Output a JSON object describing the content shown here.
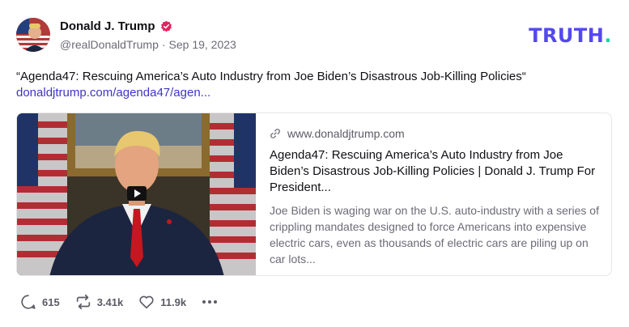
{
  "author": {
    "display_name": "Donald J. Trump",
    "handle": "@realDonaldTrump",
    "separator": "·",
    "date": "Sep 19, 2023",
    "verified_icon": "verified-badge-icon",
    "verified_color": "#e0245e"
  },
  "brand": {
    "logo_text": "TRUTH",
    "logo_dot": ".",
    "logo_color": "#5448ee",
    "logo_dot_color": "#1dd5a6"
  },
  "status": {
    "text": "“Agenda47: Rescuing America’s Auto Industry from Joe Biden’s Disastrous Job-Killing Policies“",
    "link_text": "donaldjtrump.com/agenda47/agen..."
  },
  "card": {
    "domain": "www.donaldjtrump.com",
    "link_icon": "link-icon",
    "title": "Agenda47: Rescuing America’s Auto Industry from Joe Biden’s Disastrous Job-Killing Policies | Donald J. Trump For President...",
    "description": "Joe Biden is waging war on the U.S. auto-industry with a series of crippling mandates designed to force Americans into expensive electric cars, even as thousands of electric cars are piling up on car lots...",
    "media_type": "video",
    "play_icon": "play-icon"
  },
  "actions": {
    "replies": "615",
    "retruths": "3.41k",
    "likes": "11.9k",
    "reply_icon": "reply-icon",
    "retruth_icon": "retruth-icon",
    "like_icon": "heart-icon",
    "more_icon": "more-dots-icon"
  }
}
